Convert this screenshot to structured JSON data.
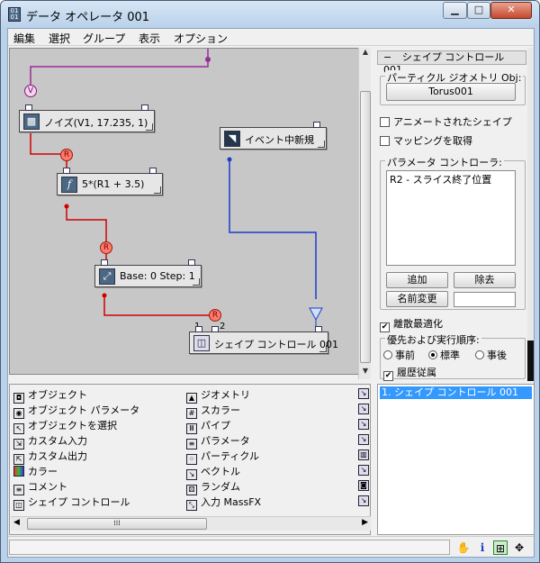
{
  "window": {
    "title": "データ オペレータ 001",
    "min_glyph": "▁",
    "max_glyph": "□",
    "close_glyph": "✕"
  },
  "menu": [
    "編集",
    "選択",
    "グループ",
    "表示",
    "オプション"
  ],
  "nodes": {
    "noise": "ノイズ(V1, 17.235, 1)",
    "event_new": "イベント中新規",
    "expr": "5*(R1 + 3.5)",
    "base": "Base: 0  Step: 1",
    "shape_ctrl": "シェイプ コントロール 001"
  },
  "badges": {
    "v": "V",
    "r": "R"
  },
  "port_labels": {
    "p1": "1",
    "p2": "2"
  },
  "panel": {
    "rollout_title": "シェイプ コントロール 001",
    "rollout_toggle": "−",
    "particle_group": "パーティクル ジオメトリ Obj:",
    "particle_obj": "Torus001",
    "animated_shape": "アニメートされたシェイプ",
    "get_mapping": "マッピングを取得",
    "param_group": "パラメータ コントローラ:",
    "param_item": "R2 - スライス終了位置",
    "add": "追加",
    "remove": "除去",
    "rename": "名前変更",
    "rename_value": "",
    "discrete_opt": "離散最適化",
    "priority_group": "優先および実行順序:",
    "radio_before": "事前",
    "radio_standard": "標準",
    "radio_after": "事後",
    "history_dep": "履歴従属"
  },
  "palette": {
    "left": [
      "オブジェクト",
      "オブジェクト パラメータ",
      "オブジェクトを選択",
      "カスタム入力",
      "カスタム出力",
      "カラー",
      "コメント",
      "シェイプ コントロール"
    ],
    "right": [
      "ジオメトリ",
      "スカラー",
      "パイプ",
      "パラメータ",
      "パーティクル",
      "ベクトル",
      "ランダム",
      "入力 MassFX"
    ]
  },
  "event_list": {
    "item": "1. シェイプ コントロール 001"
  },
  "status": {
    "text": ""
  },
  "colors": {
    "wire_red": "#d00000",
    "wire_blue": "#1a3ccc",
    "wire_purple": "#9a2a9a",
    "selection": "#3399ff"
  }
}
